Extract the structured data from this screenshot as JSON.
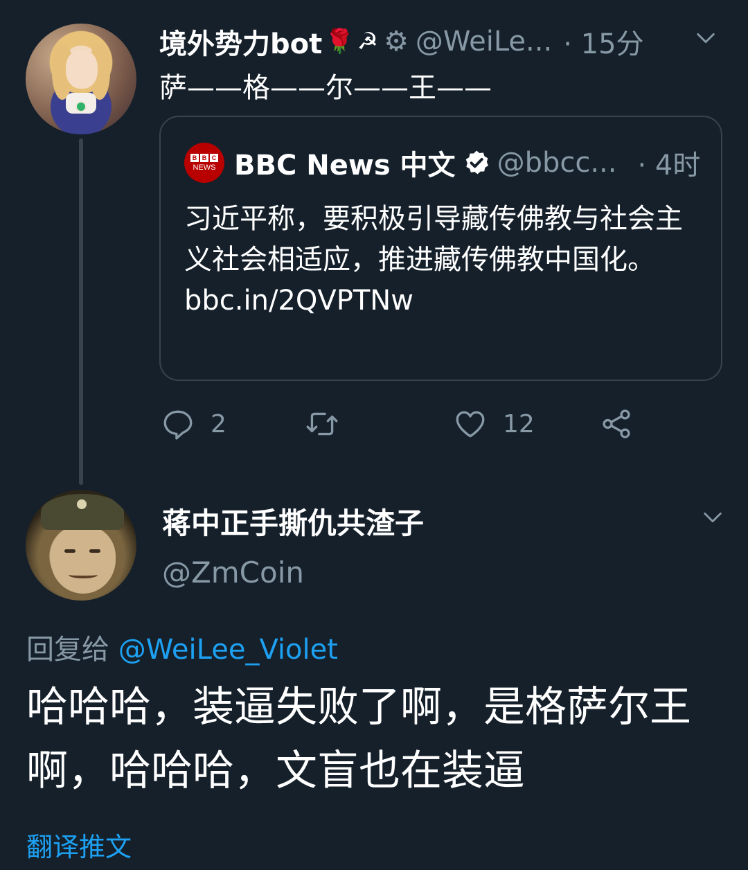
{
  "parent_tweet": {
    "display_name": "境外势力bot",
    "name_emojis": [
      "🌹",
      "☭"
    ],
    "handle": "@WeiLe...",
    "time": "· 15分",
    "text": "萨——格——尔——王——",
    "quote": {
      "logo_letters": [
        "B",
        "B",
        "C"
      ],
      "logo_text": "NEWS",
      "name": "BBC News 中文",
      "handle": "@bbcc...",
      "time": "· 4时",
      "text": "习近平称，要积极引导藏传佛教与社会主义社会相适应，推进藏传佛教中国化。",
      "link": "bbc.in/2QVPTNw"
    },
    "actions": {
      "reply_count": "2",
      "retweet_count": "",
      "like_count": "12"
    }
  },
  "reply_tweet": {
    "display_name": "蒋中正手撕仇共渣子",
    "handle": "@ZmCoin",
    "replying_to_label": "回复给",
    "replying_to_handle": "@WeiLee_Violet",
    "text": "哈哈哈，装逼失败了啊，是格萨尔王啊，哈哈哈，文盲也在装逼",
    "translate_label": "翻译推文"
  },
  "colors": {
    "background": "#15202b",
    "secondary_text": "#8899a6",
    "link_blue": "#1da1f2",
    "border": "#38444d",
    "bbc_red": "#b80000"
  },
  "icons": [
    "gear-icon",
    "chevron-down-icon",
    "verified-badge-icon",
    "reply-icon",
    "retweet-icon",
    "like-icon",
    "share-icon"
  ]
}
